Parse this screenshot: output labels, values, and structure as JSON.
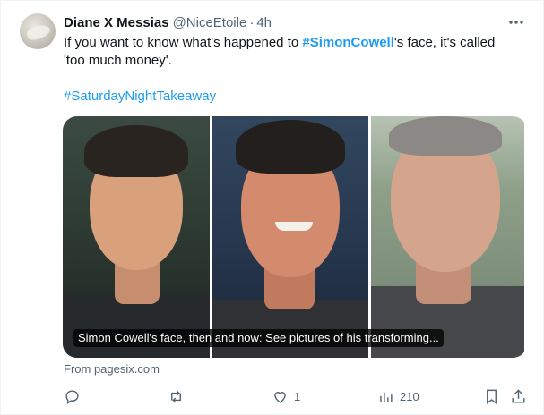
{
  "author": {
    "name": "Diane X Messias",
    "handle": "@NiceEtoile",
    "separator": "·",
    "time": "4h",
    "avatar_icon": "avatar-image"
  },
  "tweet": {
    "text_prefix": "If you want to know what's happened to ",
    "hashtag_inline": "#SimonCowell",
    "text_suffix": "'s face, it's called",
    "line2": "'too much money'.",
    "hashtag_line": "#SaturdayNightTakeaway"
  },
  "card": {
    "caption": "Simon Cowell's face, then and now: See pictures of his transforming...",
    "source": "From pagesix.com"
  },
  "actions": {
    "reply_icon": "reply-icon",
    "retweet_icon": "retweet-icon",
    "like_icon": "heart-icon",
    "like_count": "1",
    "views_icon": "views-icon",
    "views_count": "210",
    "bookmark_icon": "bookmark-icon",
    "share_icon": "share-icon"
  },
  "colors": {
    "accent": "#1d9bf0",
    "secondary_text": "#536471",
    "primary_text": "#0f1419"
  }
}
